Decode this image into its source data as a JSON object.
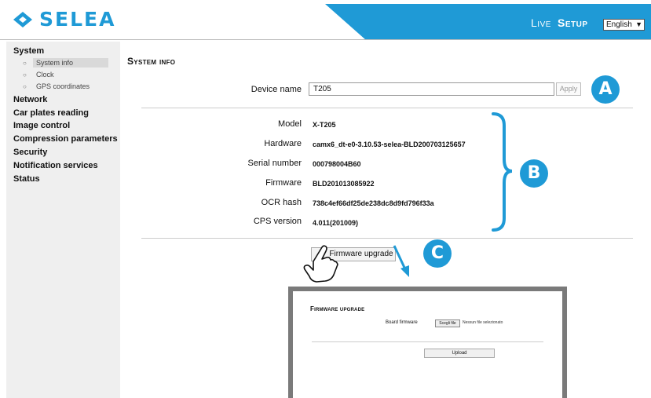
{
  "header": {
    "brand": "SELEA",
    "nav_live": "Live",
    "nav_setup": "Setup",
    "language": "English",
    "accent_color": "#1f9ad6"
  },
  "sidebar": {
    "items": [
      {
        "label": "System"
      },
      {
        "label": "Network"
      },
      {
        "label": "Car plates reading"
      },
      {
        "label": "Image control"
      },
      {
        "label": "Compression parameters"
      },
      {
        "label": "Security"
      },
      {
        "label": "Notification services"
      },
      {
        "label": "Status"
      }
    ],
    "sub_items": [
      {
        "label": "System info",
        "active": true
      },
      {
        "label": "Clock"
      },
      {
        "label": "GPS coordinates"
      }
    ]
  },
  "main": {
    "title": "System info",
    "device_name": {
      "label": "Device name",
      "value": "T205",
      "apply": "Apply"
    },
    "fields": [
      {
        "label": "Model",
        "value": "X-T205"
      },
      {
        "label": "Hardware",
        "value": "camx6_dt-e0-3.10.53-selea-BLD200703125657"
      },
      {
        "label": "Serial number",
        "value": "000798004B60"
      },
      {
        "label": "Firmware",
        "value": "BLD201013085922"
      },
      {
        "label": "OCR hash",
        "value": "738c4ef66df25de238dc8d9fd796f33a"
      },
      {
        "label": "CPS version",
        "value": "4.011(201009)"
      }
    ],
    "firmware_upgrade_button": "Firmware upgrade"
  },
  "badges": {
    "a": "A",
    "b": "B",
    "c": "C"
  },
  "inset": {
    "title": "Firmware upgrade",
    "board_firmware_label": "Board firmware",
    "choose_file": "Scegli file",
    "no_file": "Nessun file selezionato",
    "upload": "Upload"
  }
}
